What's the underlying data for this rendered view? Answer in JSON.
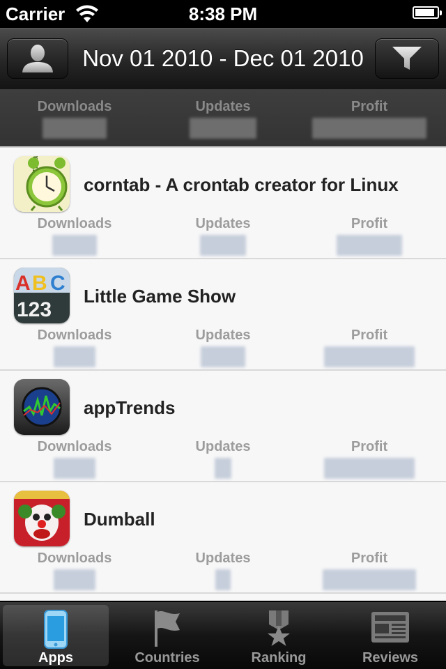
{
  "status_bar": {
    "carrier": "Carrier",
    "time": "8:38 PM",
    "battery_level": 0.9
  },
  "nav_bar": {
    "title": "Nov 01 2010 - Dec 01 2010",
    "left_button_icon": "person-icon",
    "right_button_icon": "filter-icon"
  },
  "summary": {
    "downloads_label": "Downloads",
    "updates_label": "Updates",
    "profit_label": "Profit"
  },
  "apps": [
    {
      "name": "corntab - A crontab creator for Linux",
      "icon": "alarm-clock-icon",
      "downloads_label": "Downloads",
      "updates_label": "Updates",
      "profit_label": "Profit"
    },
    {
      "name": "Little Game Show",
      "icon": "abc-123-chalkboard-icon",
      "downloads_label": "Downloads",
      "updates_label": "Updates",
      "profit_label": "Profit"
    },
    {
      "name": "appTrends",
      "icon": "trend-graph-icon",
      "downloads_label": "Downloads",
      "updates_label": "Updates",
      "profit_label": "Profit"
    },
    {
      "name": "Dumball",
      "icon": "clown-face-icon",
      "downloads_label": "Downloads",
      "updates_label": "Updates",
      "profit_label": "Profit"
    }
  ],
  "tab_bar": {
    "tabs": [
      {
        "label": "Apps",
        "icon": "iphone-icon",
        "active": true
      },
      {
        "label": "Countries",
        "icon": "flag-icon",
        "active": false
      },
      {
        "label": "Ranking",
        "icon": "star-medal-icon",
        "active": false
      },
      {
        "label": "Reviews",
        "icon": "newspaper-icon",
        "active": false
      }
    ]
  },
  "colors": {
    "nav_dark": "#262626",
    "label_gray": "#9c9c9c",
    "row_bg": "#f7f7f7",
    "blurred_value": "#c6cedb"
  }
}
